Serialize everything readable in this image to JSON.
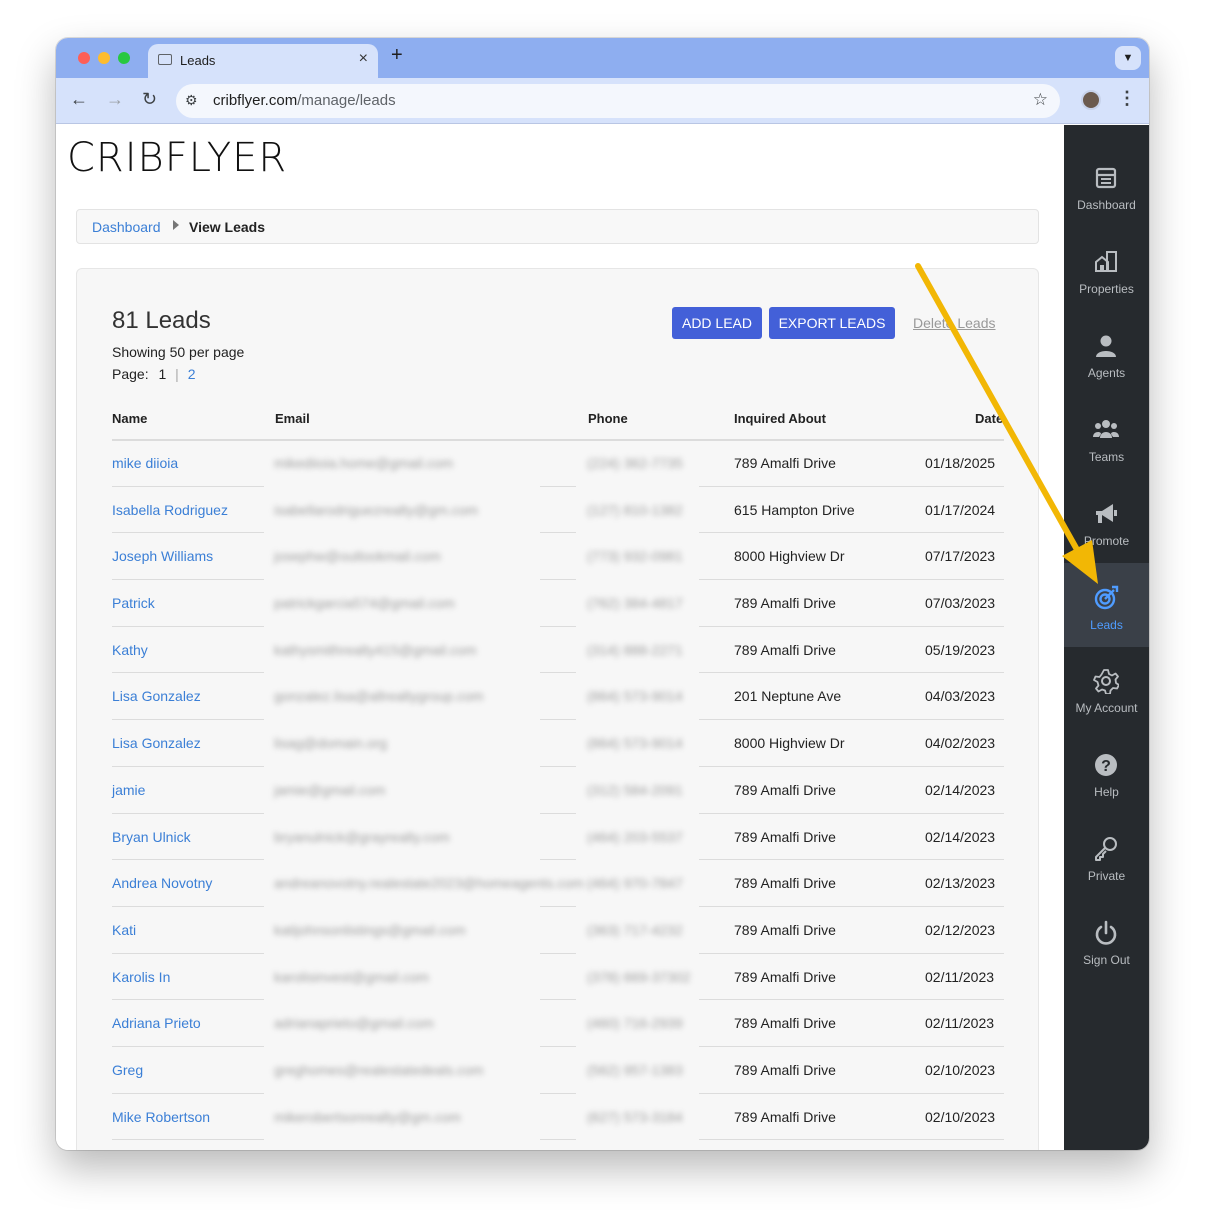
{
  "browser": {
    "tab_title": "Leads",
    "tab_close": "×",
    "new_tab": "+",
    "url_domain": "cribflyer.com",
    "url_path": "/manage/leads"
  },
  "logo": "CRIBFLYER",
  "breadcrumb": {
    "link": "Dashboard",
    "current": "View Leads"
  },
  "header": {
    "count": "81 Leads",
    "per_page": "Showing 50 per page",
    "page_label": "Page:",
    "page_current": "1",
    "page_separator": "|",
    "page_next": "2"
  },
  "buttons": {
    "add": "ADD LEAD",
    "export": "EXPORT LEADS",
    "delete": "Delete Leads"
  },
  "table": {
    "columns": [
      "Name",
      "Email",
      "Phone",
      "Inquired About",
      "Date"
    ],
    "rows": [
      {
        "name": "mike diioia",
        "email": "mikediioia.home@gmail.com",
        "phone": "(224) 362-7735",
        "inquired": "789 Amalfi Drive",
        "date": "01/18/2025"
      },
      {
        "name": "Isabella Rodriguez",
        "email": "isabellarodriguezrealty@gm.com",
        "phone": "(127) 810-1382",
        "inquired": "615 Hampton Drive",
        "date": "01/17/2024"
      },
      {
        "name": "Joseph Williams",
        "email": "josephw@outlookmail.com",
        "phone": "(773) 932-0981",
        "inquired": "8000 Highview Dr",
        "date": "07/17/2023"
      },
      {
        "name": "Patrick",
        "email": "patrickgarcia574@gmail.com",
        "phone": "(762) 384-4817",
        "inquired": "789 Amalfi Drive",
        "date": "07/03/2023"
      },
      {
        "name": "Kathy",
        "email": "kathysmithrealty415@gmail.com",
        "phone": "(314) 888-2271",
        "inquired": "789 Amalfi Drive",
        "date": "05/19/2023"
      },
      {
        "name": "Lisa Gonzalez",
        "email": "gonzalez.lisa@allrealtygroup.com",
        "phone": "(864) 573-9014",
        "inquired": "201 Neptune Ave",
        "date": "04/03/2023"
      },
      {
        "name": "Lisa Gonzalez",
        "email": "lisag@domain.org",
        "phone": "(864) 573-9014",
        "inquired": "8000 Highview Dr",
        "date": "04/02/2023"
      },
      {
        "name": "jamie",
        "email": "jamie@gmail.com",
        "phone": "(312) 584-2091",
        "inquired": "789 Amalfi Drive",
        "date": "02/14/2023"
      },
      {
        "name": "Bryan Ulnick",
        "email": "bryanulnick@grayrealty.com",
        "phone": "(464) 203-5537",
        "inquired": "789 Amalfi Drive",
        "date": "02/14/2023"
      },
      {
        "name": "Andrea Novotny",
        "email": "andreanovotny.realestate2023@homeagents.com",
        "phone": "(464) 970-7847",
        "inquired": "789 Amalfi Drive",
        "date": "02/13/2023"
      },
      {
        "name": "Kati",
        "email": "katijohnsonlistings@gmail.com",
        "phone": "(363) 717-4232",
        "inquired": "789 Amalfi Drive",
        "date": "02/12/2023"
      },
      {
        "name": "Karolis In",
        "email": "karolisinvest@gmail.com",
        "phone": "(378) 669-37302",
        "inquired": "789 Amalfi Drive",
        "date": "02/11/2023"
      },
      {
        "name": "Adriana Prieto",
        "email": "adrianaprieto@gmail.com",
        "phone": "(460) 716-2939",
        "inquired": "789 Amalfi Drive",
        "date": "02/11/2023"
      },
      {
        "name": "Greg",
        "email": "greghomes@realestatedeals.com",
        "phone": "(562) 957-1383",
        "inquired": "789 Amalfi Drive",
        "date": "02/10/2023"
      },
      {
        "name": "Mike Robertson",
        "email": "mikerobertsonrealty@gm.com",
        "phone": "(627) 573-3184",
        "inquired": "789 Amalfi Drive",
        "date": "02/10/2023"
      }
    ]
  },
  "sidebar": {
    "items": [
      {
        "label": "Dashboard",
        "icon": "dashboard-icon"
      },
      {
        "label": "Properties",
        "icon": "properties-icon"
      },
      {
        "label": "Agents",
        "icon": "agent-icon"
      },
      {
        "label": "Teams",
        "icon": "teams-icon"
      },
      {
        "label": "Promote",
        "icon": "megaphone-icon"
      },
      {
        "label": "Leads",
        "icon": "target-icon",
        "active": true
      },
      {
        "label": "My Account",
        "icon": "gear-icon"
      },
      {
        "label": "Help",
        "icon": "help-icon"
      },
      {
        "label": "Private",
        "icon": "key-icon"
      },
      {
        "label": "Sign Out",
        "icon": "power-icon"
      }
    ]
  },
  "colors": {
    "accent": "#4360d8",
    "link": "#3b7fd6",
    "sidebar_bg": "#262a2e",
    "arrow": "#f2b705"
  }
}
